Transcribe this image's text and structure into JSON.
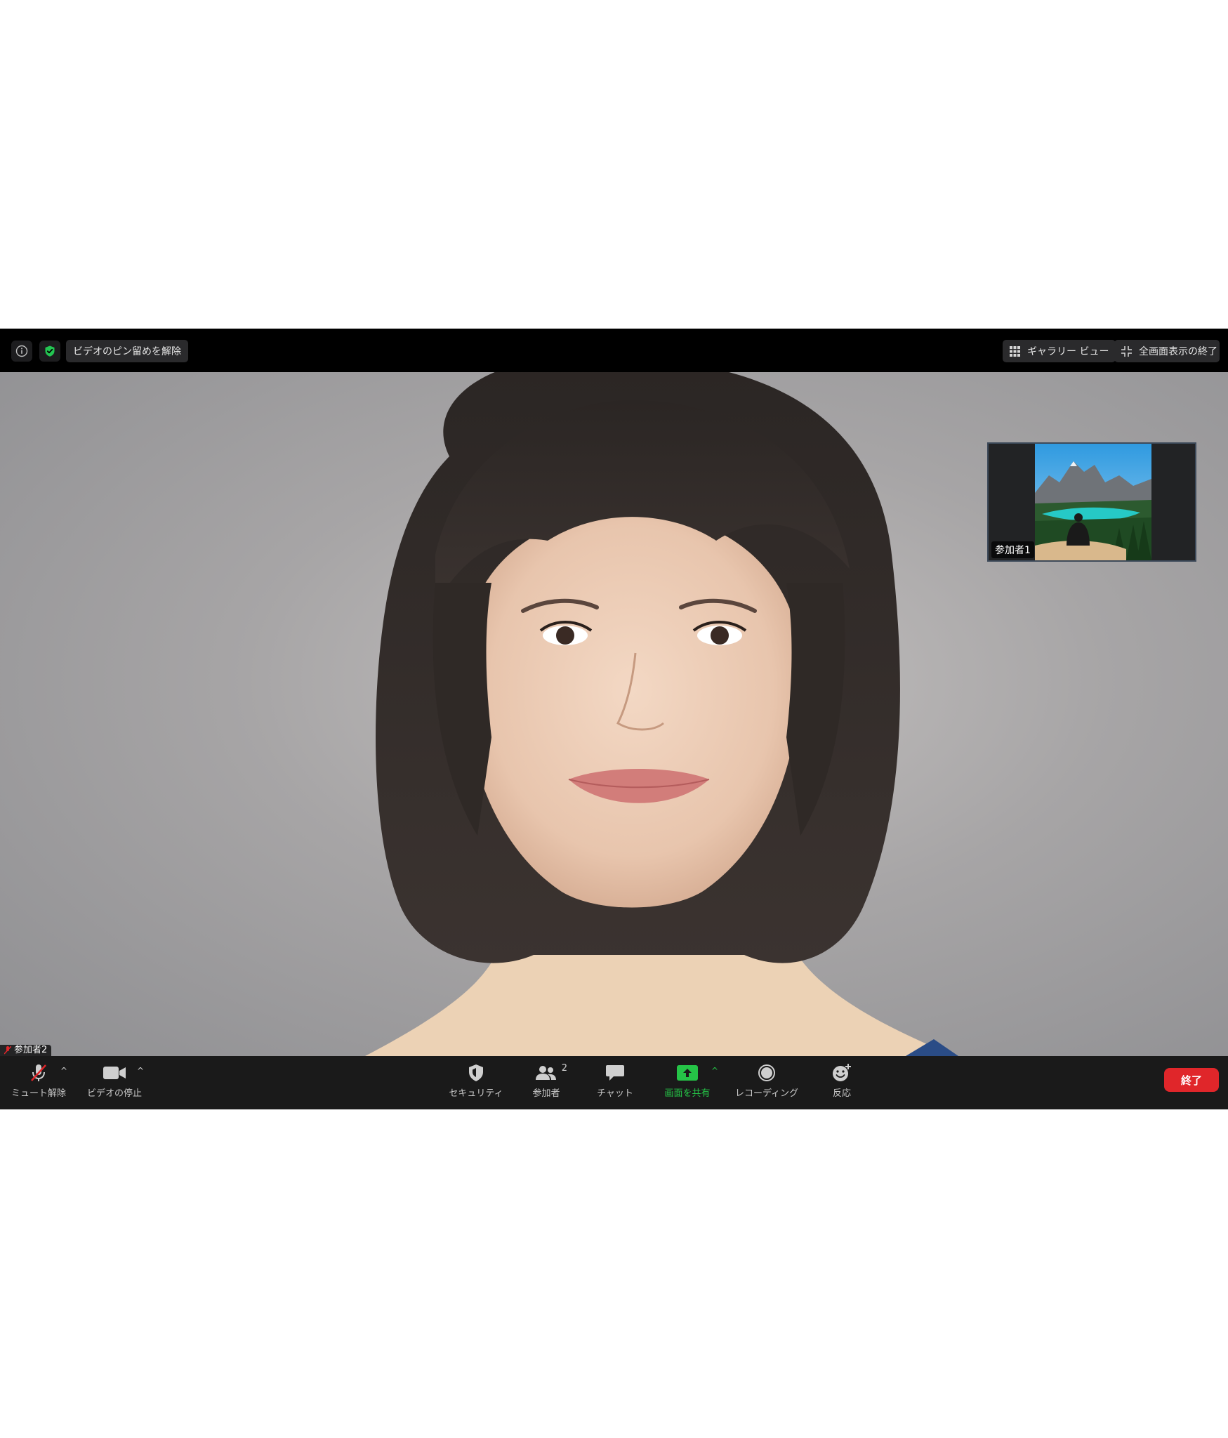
{
  "topbar": {
    "unpin_label": "ビデオのピン留めを解除",
    "gallery_view_label": "ギャラリー ビュー",
    "exit_fullscreen_label": "全画面表示の終了"
  },
  "video": {
    "main_participant_name": "参加者2",
    "thumbnail_participant_name": "参加者1"
  },
  "toolbar": {
    "unmute_label": "ミュート解除",
    "stop_video_label": "ビデオの停止",
    "security_label": "セキュリティ",
    "participants_label": "参加者",
    "participants_count": "2",
    "chat_label": "チャット",
    "share_screen_label": "画面を共有",
    "record_label": "レコーディング",
    "reactions_label": "反応",
    "end_label": "終了"
  },
  "colors": {
    "share_green": "#25c447",
    "end_red": "#e0262a",
    "shield_green": "#23c552"
  }
}
